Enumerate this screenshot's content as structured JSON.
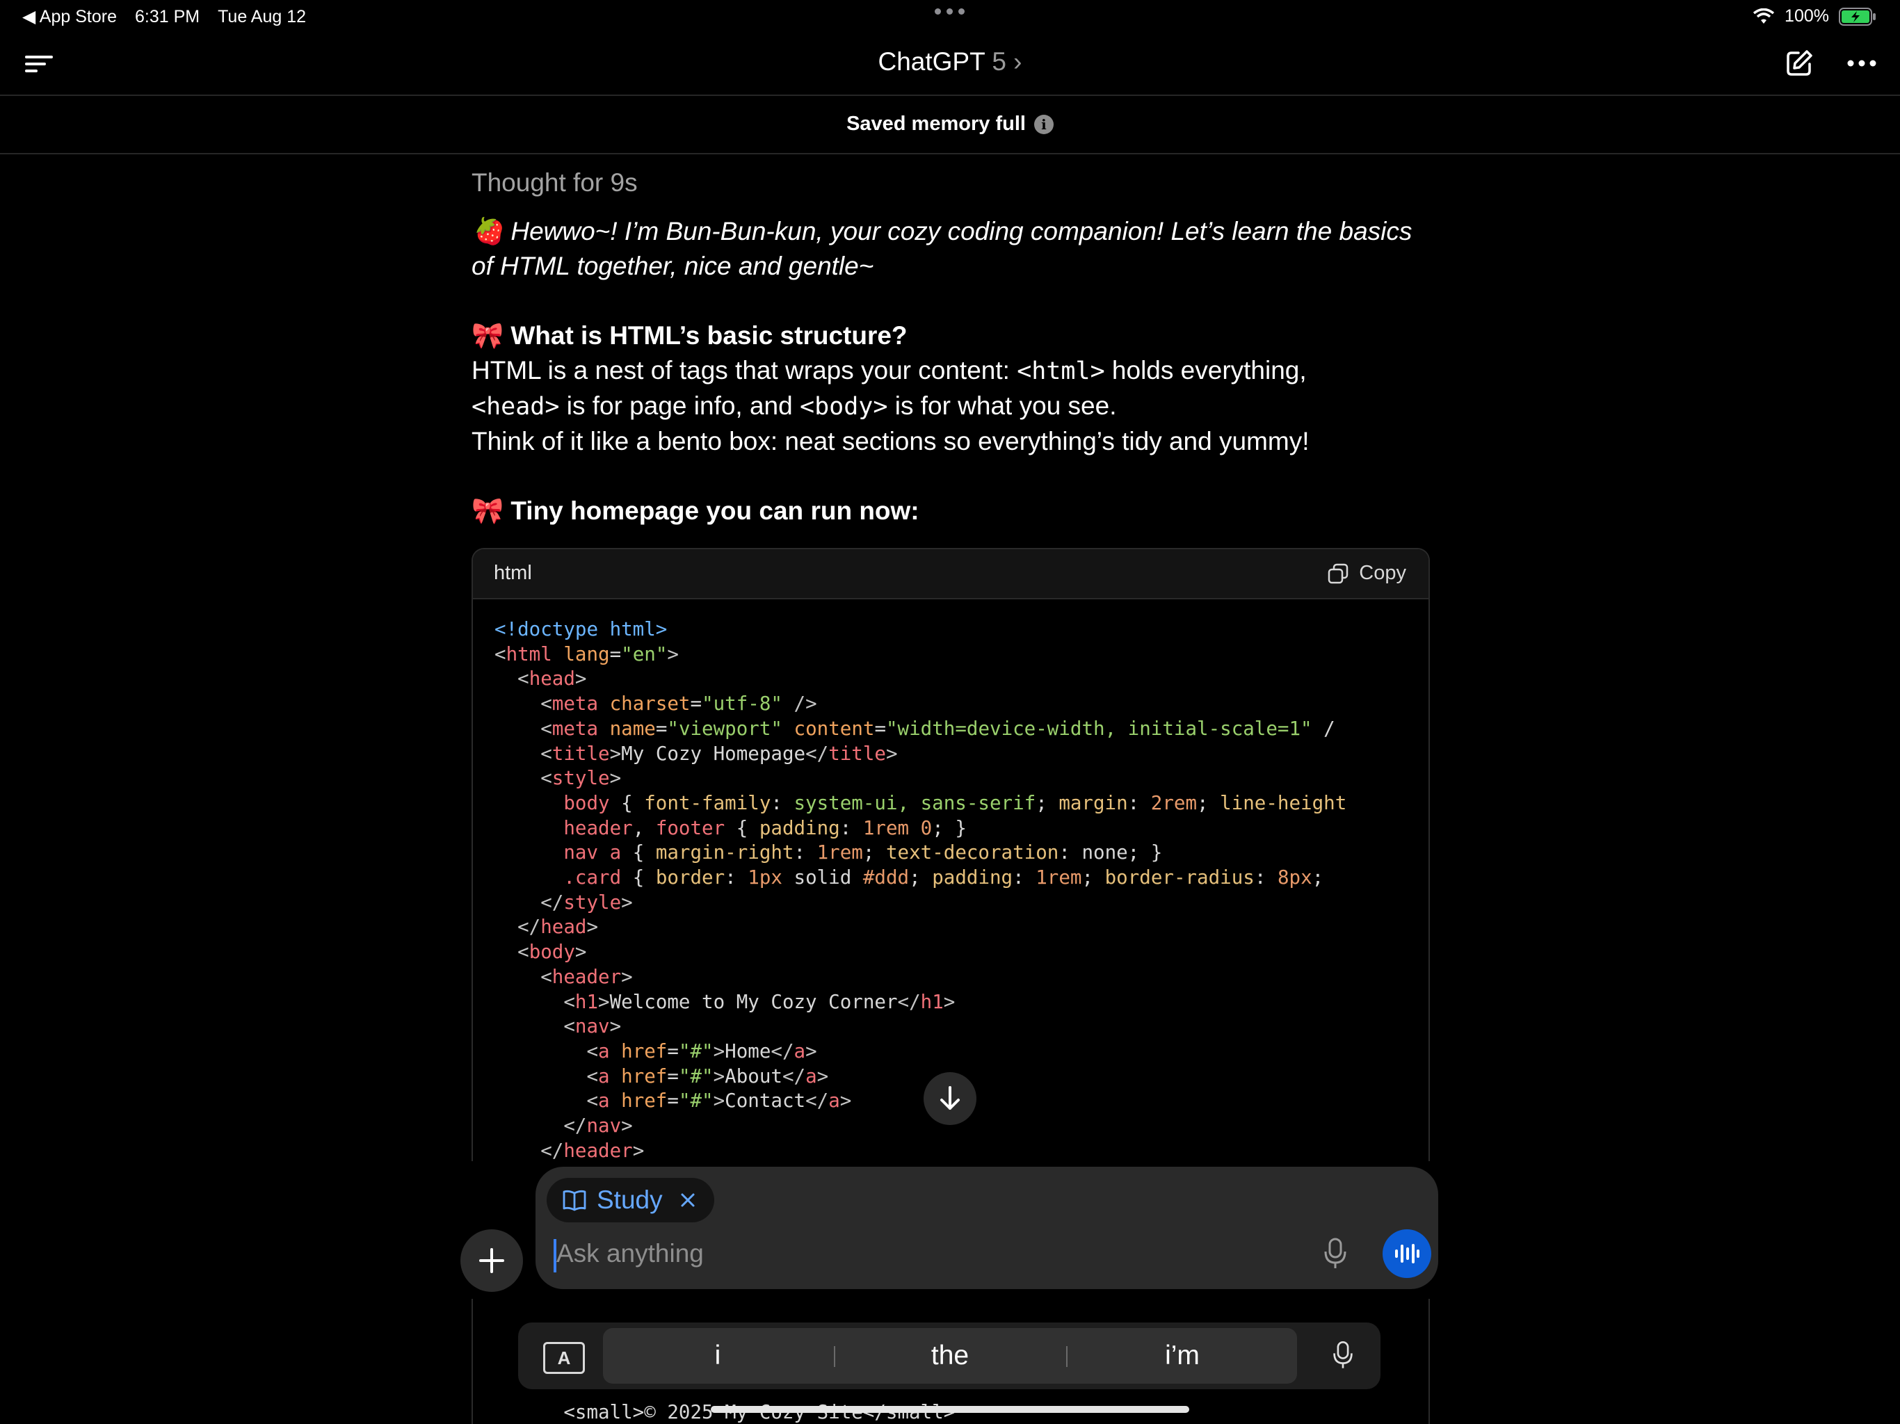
{
  "status_bar": {
    "back_app": "◀ App Store",
    "time": "6:31 PM",
    "date": "Tue Aug 12",
    "battery": "100%"
  },
  "nav": {
    "title": "ChatGPT",
    "version": "5",
    "chevron": "›"
  },
  "memory_banner": {
    "text": "Saved memory full",
    "info": "i"
  },
  "message": {
    "thought": "Thought for 9s",
    "intro_emoji": "🍓",
    "intro": "Hewwo~! I’m Bun-Bun-kun, your cozy coding companion! Let’s learn the basics of HTML together, nice and gentle~",
    "heading1_emoji": "🎀",
    "heading1": "What is HTML’s basic structure?",
    "p1_a": "HTML is a nest of tags that wraps your content: ",
    "p1_code1": "<html>",
    "p1_b": " holds everything,",
    "p1_code2": "<head>",
    "p1_c": " is for page info, and ",
    "p1_code3": "<body>",
    "p1_d": " is for what you see.",
    "p2": "Think of it like a bento box: neat sections so everything’s tidy and yummy!",
    "heading2_emoji": "🎀",
    "heading2": "Tiny homepage you can run now:"
  },
  "code_block": {
    "language": "html",
    "copy_label": "Copy"
  },
  "composer": {
    "mode_chip": "Study",
    "placeholder": "Ask anything"
  },
  "keyboard": {
    "suggestions": [
      "i",
      "the",
      "i’m"
    ],
    "format_key": "A"
  },
  "bottom_code_line": "<small>© 2025 My Cozy Site</small>"
}
